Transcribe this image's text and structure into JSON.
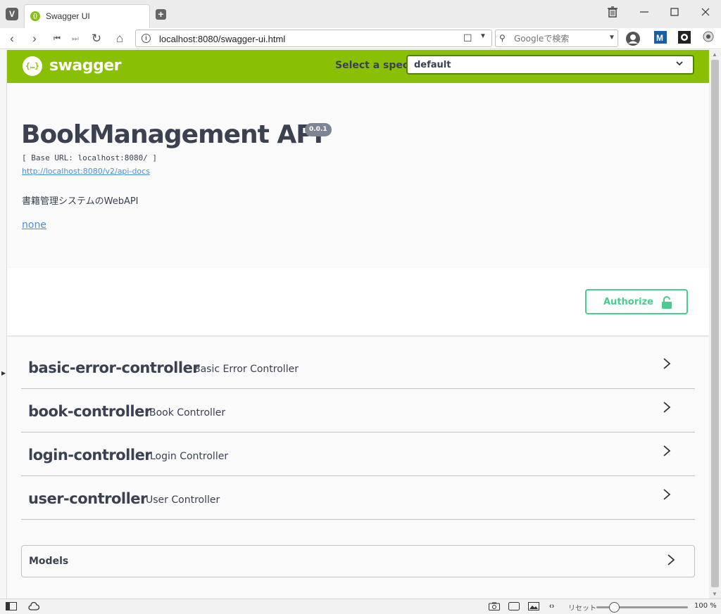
{
  "browser": {
    "menu_icon": "vivaldi-logo",
    "tab_title": "Swagger UI",
    "url": "localhost:8080/swagger-ui.html",
    "search_placeholder": "Googleで検索",
    "window_controls": [
      "trash",
      "minimize",
      "maximize",
      "close"
    ]
  },
  "swagger": {
    "logo_text": "swagger",
    "spec_label": "Select a spec",
    "spec_selected": "default",
    "title": "BookManagement API",
    "version": "0.0.1",
    "base_url": "[ Base URL: localhost:8080/ ]",
    "spec_url": "http://localhost:8080/v2/api-docs",
    "description": "書籍管理システムのWebAPI",
    "contact": "none",
    "authorize_label": "Authorize",
    "tags": [
      {
        "name": "basic-error-controller",
        "desc": "Basic Error Controller"
      },
      {
        "name": "book-controller",
        "desc": "Book Controller"
      },
      {
        "name": "login-controller",
        "desc": "Login Controller"
      },
      {
        "name": "user-controller",
        "desc": "User Controller"
      }
    ],
    "models_label": "Models"
  },
  "statusbar": {
    "reset_label": "リセット",
    "zoom": "100 %"
  },
  "colors": {
    "swagger_green": "#89bf04",
    "authorize_green": "#49cc90",
    "link_blue": "#4990e2",
    "text_dark": "#3b4151"
  }
}
